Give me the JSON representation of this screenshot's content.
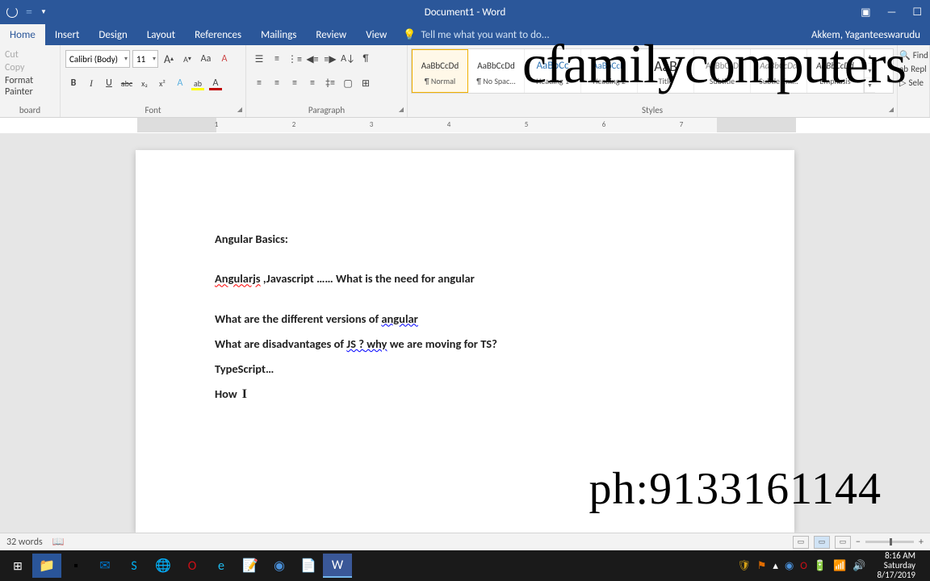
{
  "title_bar": {
    "doc_title": "Document1 - Word"
  },
  "tabs": {
    "home": "Home",
    "insert": "Insert",
    "design": "Design",
    "layout": "Layout",
    "references": "References",
    "mailings": "Mailings",
    "review": "Review",
    "view": "View",
    "tell_me": "Tell me what you want to do...",
    "user": "Akkem, Yaganteeswarudu"
  },
  "clipboard": {
    "cut": "Cut",
    "copy": "Copy",
    "paste": "Format Painter",
    "label": "board"
  },
  "font": {
    "name": "Calibri (Body)",
    "size": "11",
    "label": "Font",
    "grow": "A",
    "shrink": "A",
    "case": "Aa",
    "clear": "A",
    "bold": "B",
    "italic": "I",
    "underline": "U",
    "strike": "abc",
    "sub": "x₂",
    "sup": "x²",
    "effects": "A",
    "highlight": "ab",
    "color": "A"
  },
  "paragraph": {
    "label": "Paragraph"
  },
  "styles": {
    "label": "Styles",
    "items": [
      {
        "preview": "AaBbCcDd",
        "name": "¶ Normal"
      },
      {
        "preview": "AaBbCcDd",
        "name": "¶ No Spac..."
      },
      {
        "preview": "AaBbCc",
        "name": "Heading 1"
      },
      {
        "preview": "AaBbCcD",
        "name": "Heading 2"
      },
      {
        "preview": "AaB",
        "name": "Title"
      },
      {
        "preview": "AaBbCcD",
        "name": "Subtitle"
      },
      {
        "preview": "AaBbCcDd",
        "name": "Subtle Em..."
      },
      {
        "preview": "AaBbCcDd",
        "name": "Emphasis"
      }
    ]
  },
  "editing": {
    "find": "Find",
    "replace": "Repl",
    "select": "Sele"
  },
  "ruler": {
    "marks": [
      "1",
      "2",
      "3",
      "4",
      "5",
      "6",
      "7"
    ]
  },
  "document": {
    "line1": "Angular Basics:",
    "line2a": "Angularjs",
    "line2b": " ,Javascript ……   What is the need for angular",
    "line3a": "What are the different versions of ",
    "line3b": "angular",
    "line4a": "What are disadvantages of ",
    "line4b": "JS ?",
    "line4c": " why",
    "line4d": " we are moving for TS?",
    "line5": "TypeScript…",
    "line6": "How"
  },
  "watermark": {
    "brand": "cfamilycomputers",
    "phone": "ph:9133161144"
  },
  "status": {
    "words": "32 words"
  },
  "taskbar": {
    "time": "8:16 AM",
    "day": "Saturday",
    "date": "8/17/2019"
  }
}
